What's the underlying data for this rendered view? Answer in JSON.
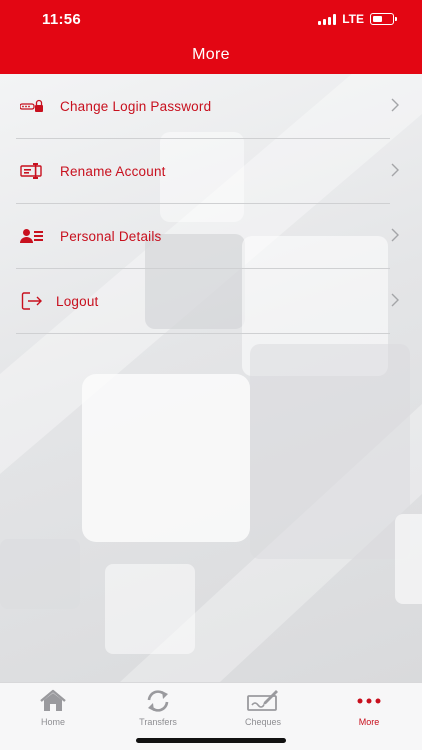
{
  "status_bar": {
    "time": "11:56",
    "network": "LTE"
  },
  "header": {
    "title": "More"
  },
  "menu": [
    {
      "label": "Change Login Password",
      "icon": "password-icon"
    },
    {
      "label": "Rename Account",
      "icon": "rename-icon"
    },
    {
      "label": "Personal Details",
      "icon": "personal-details-icon"
    },
    {
      "label": "Logout",
      "icon": "logout-icon"
    }
  ],
  "tabbar": {
    "tabs": [
      {
        "label": "Home",
        "icon": "home-icon",
        "active": false
      },
      {
        "label": "Transfers",
        "icon": "transfers-icon",
        "active": false
      },
      {
        "label": "Cheques",
        "icon": "cheque-icon",
        "active": false
      },
      {
        "label": "More",
        "icon": "more-dots-icon",
        "active": true
      }
    ]
  },
  "colors": {
    "brand_red": "#e30613",
    "label_red": "#c8101e",
    "tab_inactive": "#8e8e92"
  }
}
